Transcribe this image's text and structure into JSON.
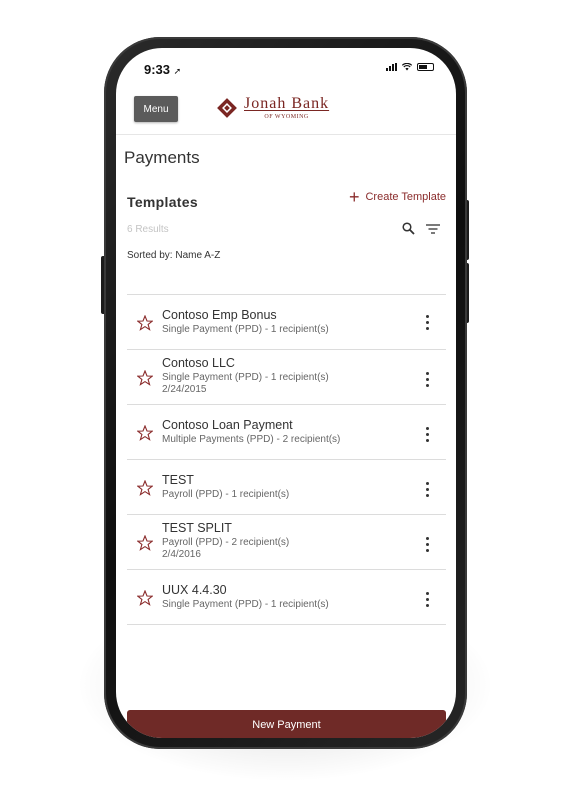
{
  "status_bar": {
    "time": "9:33"
  },
  "header": {
    "menu_label": "Menu",
    "logo_name": "Jonah Bank",
    "logo_sub": "OF WYOMING",
    "brand_color": "#7a2622"
  },
  "page": {
    "title": "Payments"
  },
  "templates": {
    "title": "Templates",
    "create_label": "Create Template",
    "results": "6 Results",
    "sorted_by": "Sorted by: Name A-Z"
  },
  "rows": [
    {
      "name": "Contoso Emp Bonus",
      "detail": "Single Payment (PPD) - 1 recipient(s)",
      "date": ""
    },
    {
      "name": "Contoso LLC",
      "detail": "Single Payment (PPD) - 1 recipient(s)",
      "date": "2/24/2015"
    },
    {
      "name": "Contoso Loan Payment",
      "detail": "Multiple Payments (PPD) - 2 recipient(s)",
      "date": ""
    },
    {
      "name": "TEST",
      "detail": "Payroll (PPD) - 1 recipient(s)",
      "date": ""
    },
    {
      "name": "TEST SPLIT",
      "detail": "Payroll (PPD) - 2 recipient(s)",
      "date": "2/4/2016"
    },
    {
      "name": "UUX 4.4.30",
      "detail": "Single Payment (PPD) - 1 recipient(s)",
      "date": ""
    }
  ],
  "footer": {
    "new_payment_label": "New Payment",
    "button_color": "#6f2a27"
  }
}
